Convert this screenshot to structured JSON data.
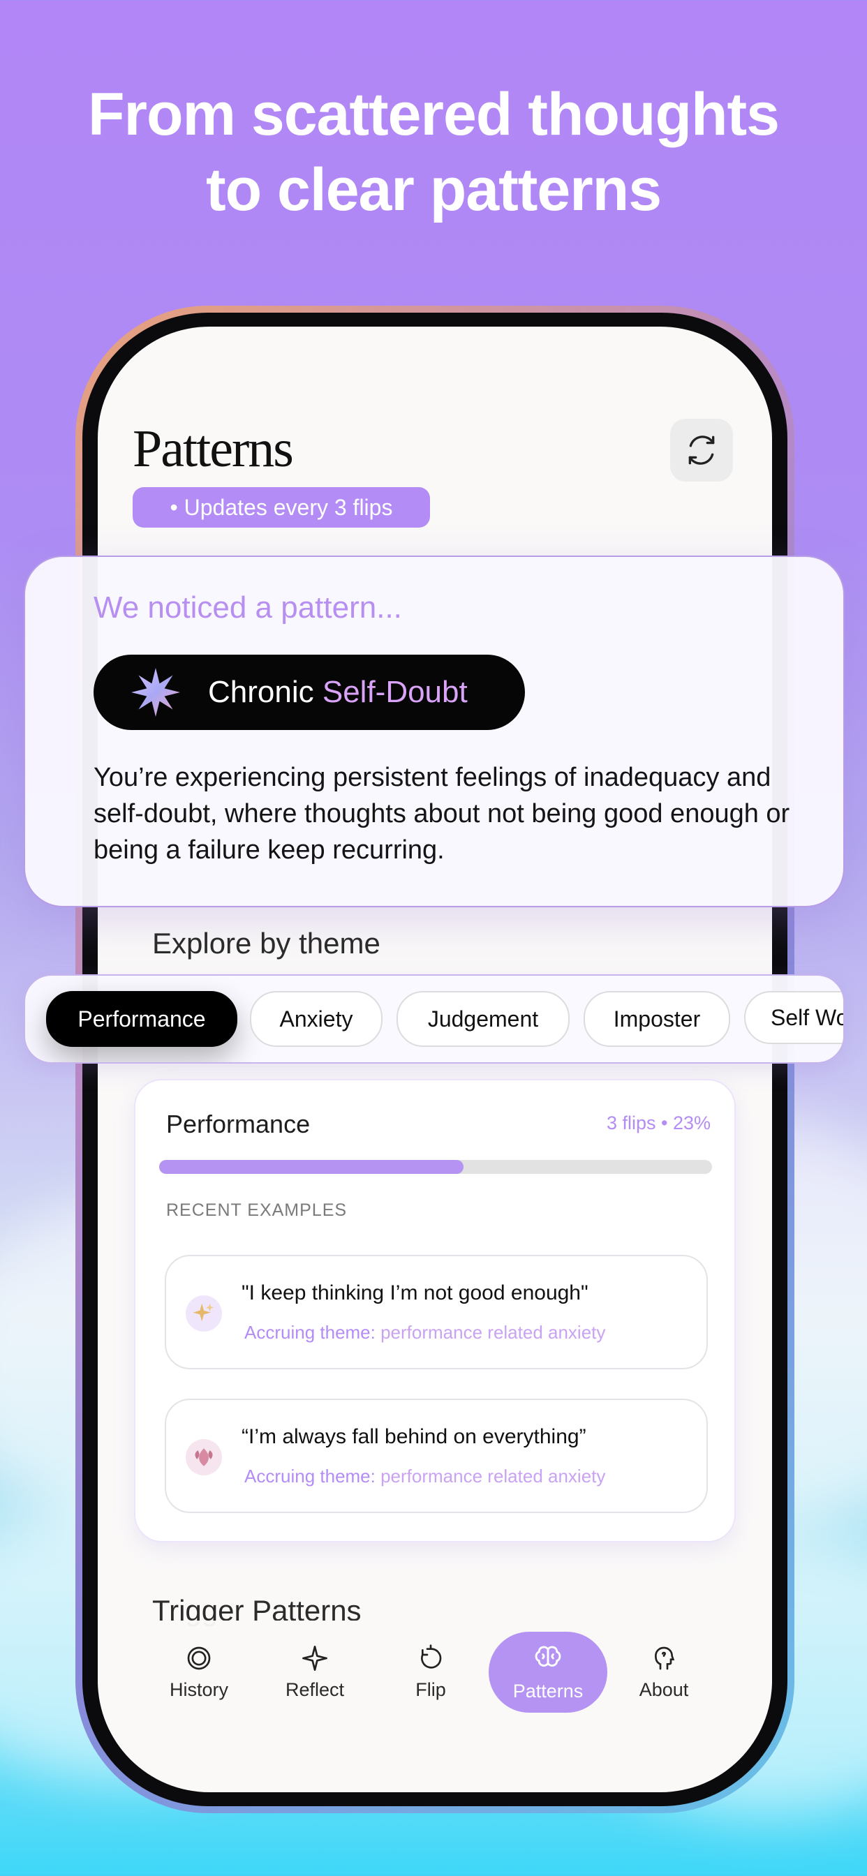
{
  "headline": {
    "line1": "From scattered thoughts",
    "line2": "to clear patterns"
  },
  "screen": {
    "title": "Patterns",
    "updates_pill": "• Updates every 3 flips",
    "refresh_icon": "refresh-icon"
  },
  "pattern_card": {
    "heading": "We noticed a pattern...",
    "pill_word1": "Chronic ",
    "pill_word2": "Self-Doubt",
    "description": "You’re experiencing persistent feelings of inadequacy and self-doubt, where thoughts about not being good enough or being a failure keep recurring."
  },
  "explore": {
    "heading": "Explore by theme",
    "chips": [
      "Performance",
      "Anxiety",
      "Judgement",
      "Imposter",
      "Self Worth"
    ],
    "active_chip": "Performance"
  },
  "theme_card": {
    "title": "Performance",
    "stats": "3 flips • 23%",
    "progress": 0.55,
    "recent_label": "RECENT EXAMPLES",
    "examples": [
      {
        "quote": "\"I keep thinking I’m not good enough\"",
        "theme_label": "Accruing theme:",
        "theme_value": " performance related anxiety",
        "icon": "sparkles-icon"
      },
      {
        "quote": "“I’m always fall behind on everything”",
        "theme_label": "Accruing theme:",
        "theme_value": " performance related anxiety",
        "icon": "leaf-icon"
      }
    ]
  },
  "trigger_heading": "Trigger Patterns",
  "nav": {
    "items": [
      {
        "label": "History",
        "icon": "history-icon"
      },
      {
        "label": "Reflect",
        "icon": "sparkle-icon"
      },
      {
        "label": "Flip",
        "icon": "flip-icon"
      },
      {
        "label": "Patterns",
        "icon": "brain-icon"
      },
      {
        "label": "About",
        "icon": "head-icon"
      }
    ],
    "active": "Patterns"
  },
  "colors": {
    "accent": "#b593f3",
    "background_top": "#b286f6",
    "background_bottom": "#3fd7f8"
  }
}
